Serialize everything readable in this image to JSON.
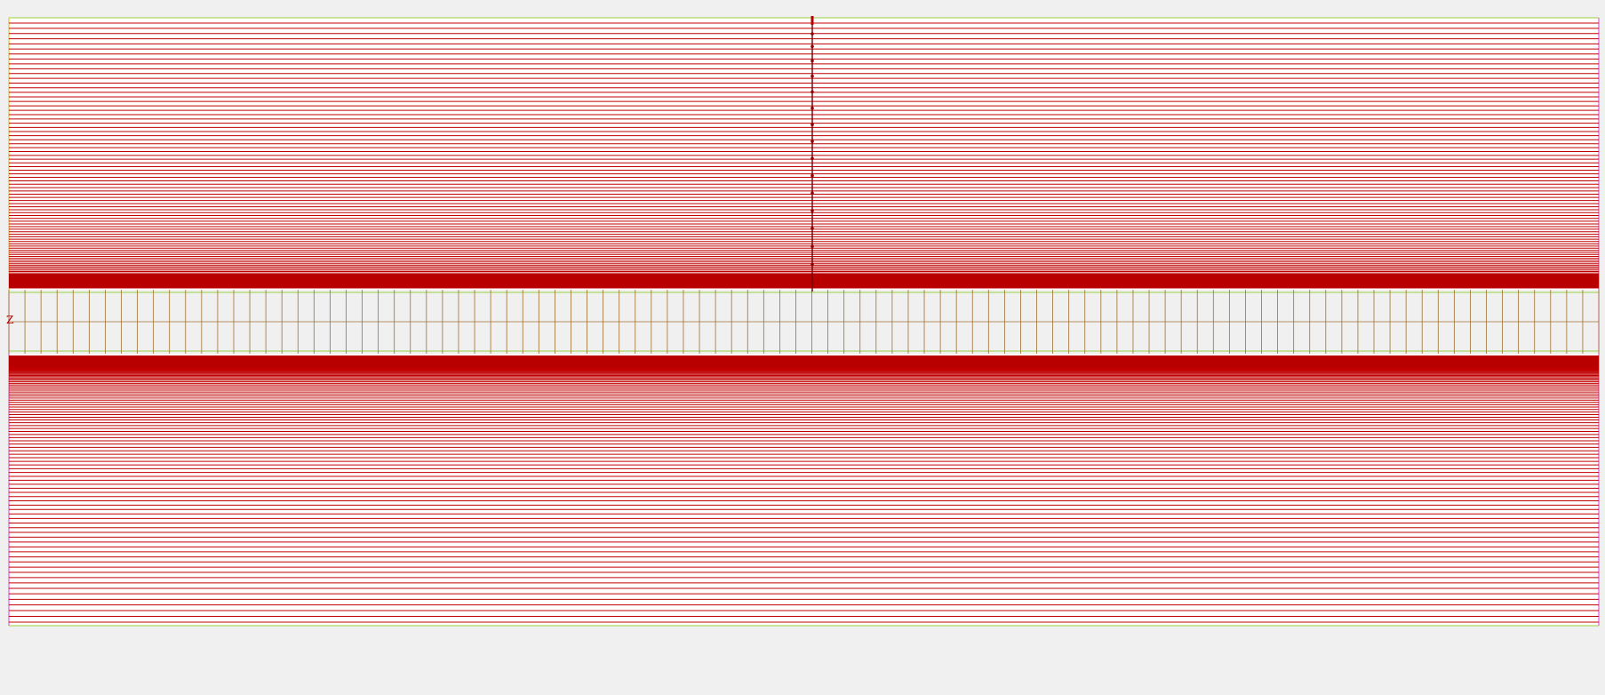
{
  "diagram": {
    "label": "Z",
    "colors": {
      "background": "#f0f0f0",
      "panel": "#ffffff",
      "red_line": "#c00000",
      "red_fill": "#b80000",
      "grid_line": "#a07030",
      "green_border": "#9ad040",
      "magenta_border": "#e040e0",
      "yellow_edge": "#d8c000"
    },
    "grid_columns": 99,
    "upper_band_lines": 96,
    "lower_band_lines": 84,
    "center_marker_count": 16
  }
}
